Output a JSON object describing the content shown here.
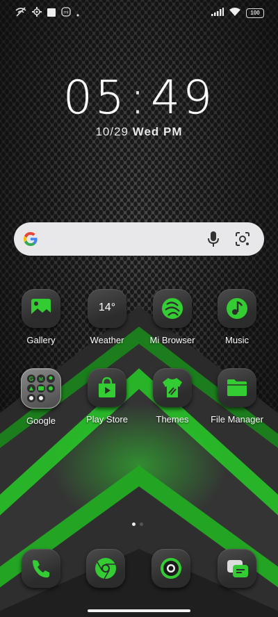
{
  "status_bar": {
    "icons_left": [
      "wifi-off-icon",
      "gear-icon",
      "square-icon",
      "mi-icon",
      "dot-icon"
    ],
    "battery": "100",
    "icons_right": [
      "signal-icon",
      "wifi-icon",
      "battery-icon"
    ]
  },
  "clock": {
    "hours": "05",
    "minutes": "49"
  },
  "date": {
    "date": "10/29",
    "day": "Wed",
    "ampm": "PM"
  },
  "search": {
    "icons": [
      "google-logo",
      "mic-icon",
      "lens-icon"
    ]
  },
  "apps_row1": [
    {
      "label": "Gallery",
      "icon": "gallery-icon"
    },
    {
      "label": "Weather",
      "icon": "weather-icon",
      "temp": "14°"
    },
    {
      "label": "Mi Browser",
      "icon": "browser-icon"
    },
    {
      "label": "Music",
      "icon": "music-icon"
    }
  ],
  "apps_row2": [
    {
      "label": "Google",
      "icon": "folder-icon"
    },
    {
      "label": "Play Store",
      "icon": "play-store-icon"
    },
    {
      "label": "Themes",
      "icon": "themes-icon"
    },
    {
      "label": "File Manager",
      "icon": "file-manager-icon"
    }
  ],
  "dock": [
    {
      "icon": "phone-icon"
    },
    {
      "icon": "chrome-icon"
    },
    {
      "icon": "camera-icon"
    },
    {
      "icon": "messages-icon"
    }
  ],
  "page_indicator": {
    "pages": 2,
    "current": 1
  },
  "colors": {
    "accent": "#33cc33",
    "background": "#1b1b1b"
  }
}
